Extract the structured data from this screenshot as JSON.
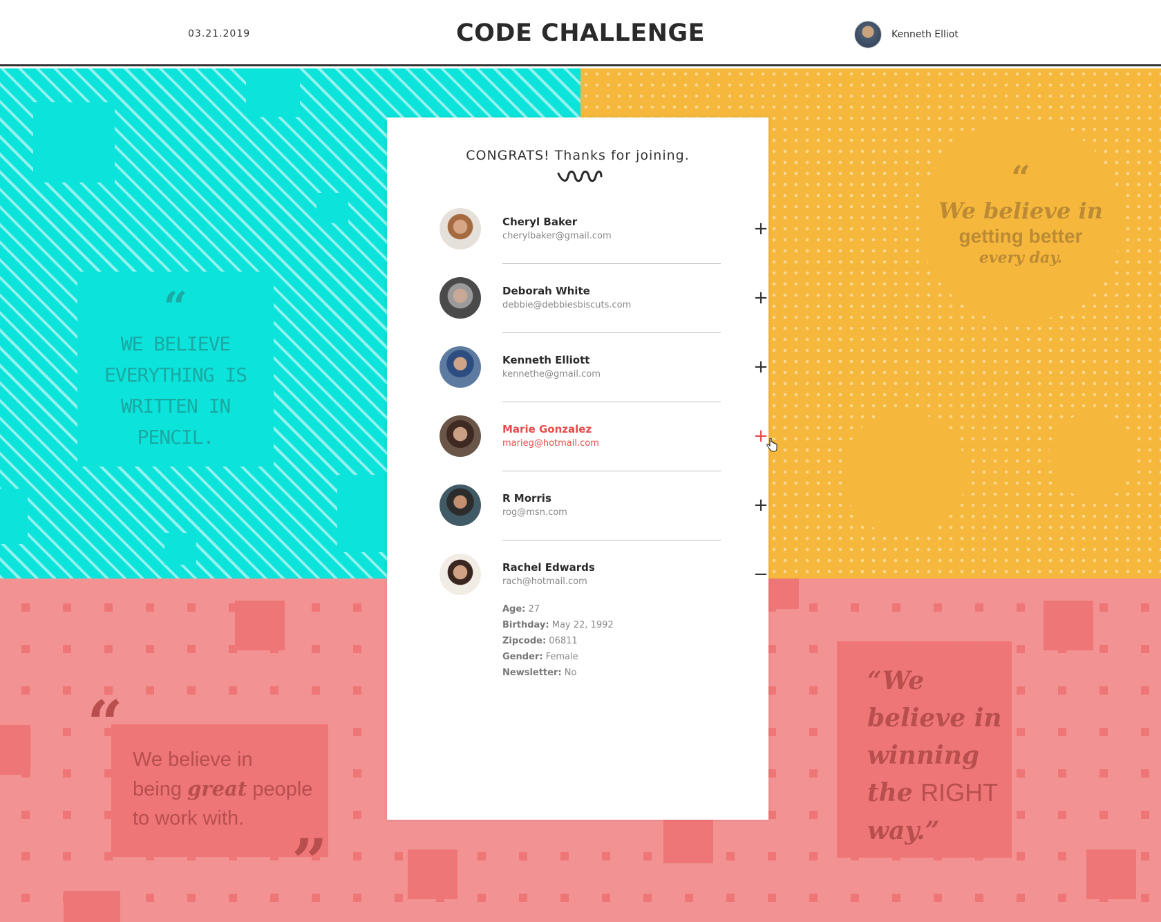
{
  "header": {
    "date": "03.21.2019",
    "title": "CODE CHALLENGE",
    "user_name": "Kenneth Elliot"
  },
  "card": {
    "congrats": "CONGRATS! Thanks for joining.",
    "people": [
      {
        "name": "Cheryl Baker",
        "email": "cherylbaker@gmail.com",
        "toggle": "+"
      },
      {
        "name": "Deborah White",
        "email": "debbie@debbiesbiscuts.com",
        "toggle": "+"
      },
      {
        "name": "Kenneth Elliott",
        "email": "kennethe@gmail.com",
        "toggle": "+"
      },
      {
        "name": "Marie Gonzalez",
        "email": "marieg@hotmail.com",
        "toggle": "+"
      },
      {
        "name": "R Morris",
        "email": "rog@msn.com",
        "toggle": "+"
      },
      {
        "name": "Rachel Edwards",
        "email": "rach@hotmail.com",
        "toggle": "−"
      }
    ],
    "details": {
      "age_label": "Age:",
      "age": "27",
      "birthday_label": "Birthday:",
      "birthday": "May 22, 1992",
      "zipcode_label": "Zipcode:",
      "zipcode": "06811",
      "gender_label": "Gender:",
      "gender": "Female",
      "newsletter_label": "Newsletter:",
      "newsletter": "No"
    }
  },
  "quotes": {
    "teal": {
      "mark": "“",
      "text": "We believe everything is written in pencil."
    },
    "yellow": {
      "mark": "“",
      "line1": "We believe in",
      "line2": "getting better",
      "line3": "every day."
    },
    "red_left": {
      "open": "“",
      "close": "”",
      "line1": "We believe in",
      "line2a": "being",
      "great": "great",
      "line2b": "people",
      "line3": "to work with."
    },
    "red_right": {
      "line1": "“We",
      "line2": "believe in",
      "line3": "winning",
      "line4a": "the",
      "right": "RIGHT",
      "line5": "way.”"
    }
  },
  "colors": {
    "teal": "#0ce3da",
    "yellow": "#f5b83c",
    "red": "#ec5858",
    "accent": "#e74c4c"
  }
}
